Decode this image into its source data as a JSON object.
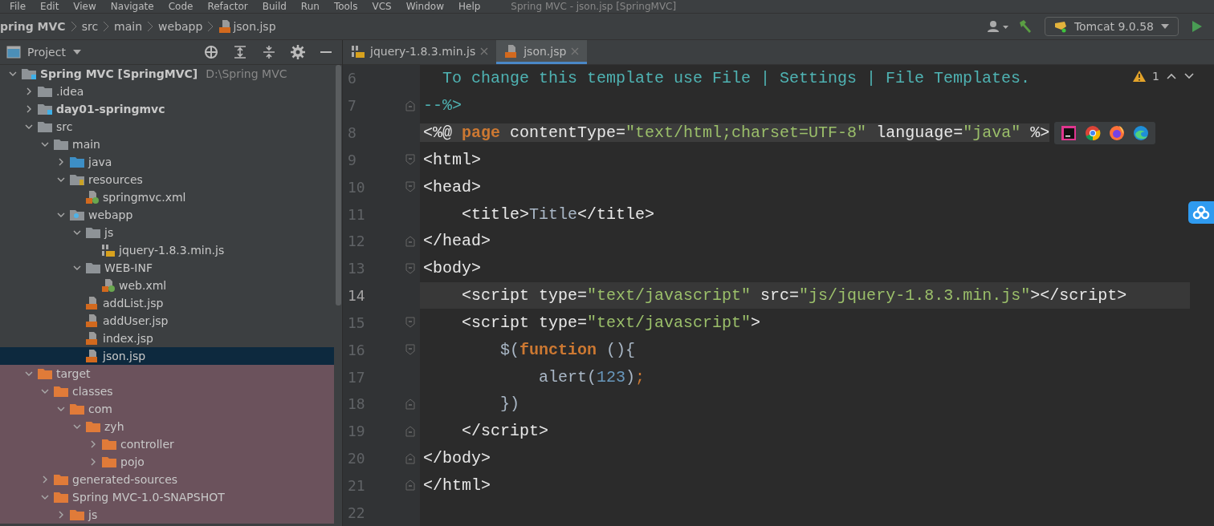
{
  "menu": [
    "File",
    "Edit",
    "View",
    "Navigate",
    "Code",
    "Refactor",
    "Build",
    "Run",
    "Tools",
    "VCS",
    "Window",
    "Help"
  ],
  "title": "Spring MVC - json.jsp [SpringMVC]",
  "breadcrumb": [
    {
      "label": "pring MVC",
      "kind": "project"
    },
    {
      "label": "src",
      "kind": "folder"
    },
    {
      "label": "main",
      "kind": "folder"
    },
    {
      "label": "webapp",
      "kind": "folder"
    },
    {
      "label": "json.jsp",
      "kind": "jsp"
    }
  ],
  "toolbar": {
    "run_config": "Tomcat 9.0.58"
  },
  "project": {
    "title": "Project",
    "tree": [
      {
        "label": "Spring MVC [SpringMVC]",
        "path": "D:\\Spring MVC",
        "kind": "module",
        "expanded": true,
        "children": [
          {
            "label": ".idea",
            "kind": "folder",
            "expanded": false
          },
          {
            "label": "day01-springmvc",
            "kind": "module",
            "expanded": false
          },
          {
            "label": "src",
            "kind": "folder",
            "expanded": true,
            "children": [
              {
                "label": "main",
                "kind": "folder",
                "expanded": true,
                "children": [
                  {
                    "label": "java",
                    "kind": "source",
                    "expanded": false
                  },
                  {
                    "label": "resources",
                    "kind": "resources",
                    "expanded": true,
                    "children": [
                      {
                        "label": "springmvc.xml",
                        "kind": "xml"
                      }
                    ]
                  },
                  {
                    "label": "webapp",
                    "kind": "web",
                    "expanded": true,
                    "children": [
                      {
                        "label": "js",
                        "kind": "folder",
                        "expanded": true,
                        "children": [
                          {
                            "label": "jquery-1.8.3.min.js",
                            "kind": "js"
                          }
                        ]
                      },
                      {
                        "label": "WEB-INF",
                        "kind": "folder",
                        "expanded": true,
                        "children": [
                          {
                            "label": "web.xml",
                            "kind": "xml"
                          }
                        ]
                      },
                      {
                        "label": "addList.jsp",
                        "kind": "jsp",
                        "selected": false
                      },
                      {
                        "label": "addUser.jsp",
                        "kind": "jsp",
                        "selected": false
                      },
                      {
                        "label": "index.jsp",
                        "kind": "jsp",
                        "selected": false
                      },
                      {
                        "label": "json.jsp",
                        "kind": "jsp",
                        "selected": true
                      }
                    ]
                  }
                ]
              }
            ]
          },
          {
            "label": "target",
            "kind": "folder",
            "excluded": true,
            "expanded": true,
            "children": [
              {
                "label": "classes",
                "kind": "folder",
                "expanded": true,
                "children": [
                  {
                    "label": "com",
                    "kind": "folder",
                    "expanded": true,
                    "children": [
                      {
                        "label": "zyh",
                        "kind": "folder",
                        "expanded": true,
                        "children": [
                          {
                            "label": "controller",
                            "kind": "folder",
                            "expanded": false
                          },
                          {
                            "label": "pojo",
                            "kind": "folder",
                            "expanded": false
                          }
                        ]
                      }
                    ]
                  }
                ]
              },
              {
                "label": "generated-sources",
                "kind": "folder",
                "expanded": false
              },
              {
                "label": "Spring MVC-1.0-SNAPSHOT",
                "kind": "folder",
                "expanded": true,
                "children": [
                  {
                    "label": "js",
                    "kind": "folder",
                    "expanded": false
                  }
                ]
              }
            ]
          }
        ]
      }
    ]
  },
  "tabs": [
    {
      "label": "jquery-1.8.3.min.js",
      "kind": "js",
      "selected": false
    },
    {
      "label": "json.jsp",
      "kind": "jsp",
      "selected": true
    }
  ],
  "editor": {
    "warnings": "1",
    "lines": [
      {
        "number": "6",
        "kind": "plain",
        "tokens": [
          {
            "kind": "comment",
            "text": "  To change this template use File | Settings | File Templates."
          }
        ]
      },
      {
        "number": "7",
        "kind": "foldend",
        "tokens": [
          {
            "kind": "comment",
            "text": "--%>"
          }
        ]
      },
      {
        "number": "8",
        "kind": "plain",
        "highlighted": true,
        "tokens": [
          {
            "kind": "tag",
            "text": "<%@ "
          },
          {
            "kind": "keyword",
            "text": "page"
          },
          {
            "kind": "tag",
            "text": " contentType="
          },
          {
            "kind": "string",
            "text": "\"text/html;charset=UTF-8\""
          },
          {
            "kind": "tag",
            "text": " language="
          },
          {
            "kind": "string",
            "text": "\"java\""
          },
          {
            "kind": "tag",
            "text": " %>"
          }
        ]
      },
      {
        "number": "9",
        "kind": "foldstart",
        "tokens": [
          {
            "kind": "tag",
            "text": "<html>"
          }
        ]
      },
      {
        "number": "10",
        "kind": "foldstart",
        "tokens": [
          {
            "kind": "tag",
            "text": "<head>"
          }
        ]
      },
      {
        "number": "11",
        "kind": "plain",
        "tokens": [
          {
            "kind": "tag",
            "text": "    <title>"
          },
          {
            "kind": "plain",
            "text": "Title"
          },
          {
            "kind": "tag",
            "text": "</title>"
          }
        ]
      },
      {
        "number": "12",
        "kind": "foldend",
        "tokens": [
          {
            "kind": "tag",
            "text": "</head>"
          }
        ]
      },
      {
        "number": "13",
        "kind": "foldstart",
        "tokens": [
          {
            "kind": "tag",
            "text": "<body>"
          }
        ]
      },
      {
        "number": "14",
        "kind": "plain",
        "current": true,
        "tokens": [
          {
            "kind": "tag",
            "text": "    <script type="
          },
          {
            "kind": "string",
            "text": "\"text/javascript\""
          },
          {
            "kind": "tag",
            "text": " src="
          },
          {
            "kind": "string",
            "text": "\"js/jquery-1.8.3.min.js\""
          },
          {
            "kind": "tag",
            "text": "></script>"
          }
        ]
      },
      {
        "number": "15",
        "kind": "foldstart",
        "tokens": [
          {
            "kind": "tag",
            "text": "    <script type="
          },
          {
            "kind": "string",
            "text": "\"text/javascript\""
          },
          {
            "kind": "tag",
            "text": ">"
          }
        ]
      },
      {
        "number": "16",
        "kind": "foldstart",
        "tokens": [
          {
            "kind": "plain",
            "text": "        $("
          },
          {
            "kind": "keyword",
            "text": "function"
          },
          {
            "kind": "plain",
            "text": " (){"
          }
        ]
      },
      {
        "number": "17",
        "kind": "plain",
        "tokens": [
          {
            "kind": "plain",
            "text": "            alert("
          },
          {
            "kind": "number",
            "text": "123"
          },
          {
            "kind": "plain",
            "text": ")"
          },
          {
            "kind": "keyword",
            "text": ";"
          }
        ]
      },
      {
        "number": "18",
        "kind": "foldend",
        "tokens": [
          {
            "kind": "plain",
            "text": "        })"
          }
        ]
      },
      {
        "number": "19",
        "kind": "foldend",
        "tokens": [
          {
            "kind": "tag",
            "text": "    </script>"
          }
        ]
      },
      {
        "number": "20",
        "kind": "foldend",
        "tokens": [
          {
            "kind": "tag",
            "text": "</body>"
          }
        ]
      },
      {
        "number": "21",
        "kind": "foldend",
        "tokens": [
          {
            "kind": "tag",
            "text": "</html>"
          }
        ]
      },
      {
        "number": "22",
        "kind": "plain"
      }
    ]
  }
}
